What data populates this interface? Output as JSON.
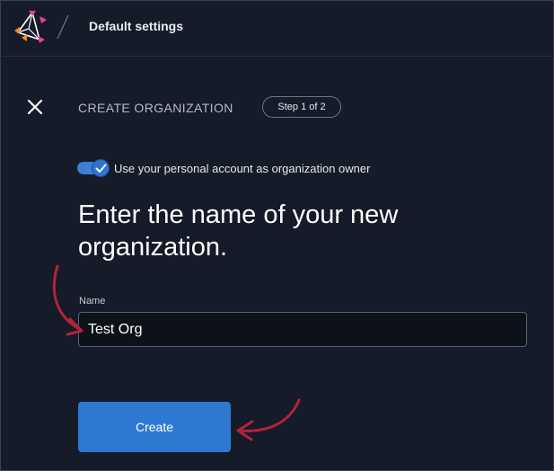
{
  "header": {
    "title": "Default settings"
  },
  "dialog": {
    "heading": "CREATE ORGANIZATION",
    "step": "Step 1 of 2",
    "toggle": {
      "label": "Use your personal account as organization owner",
      "checked": true
    },
    "main_heading": "Enter the name of your new organization.",
    "name_field": {
      "label": "Name",
      "value": "Test Org"
    },
    "create_label": "Create"
  },
  "icons": {
    "logo": "brand-logo-icon",
    "close": "close-icon",
    "check": "check-icon"
  },
  "colors": {
    "background": "#151b28",
    "accent": "#2e78d2",
    "annotation": "#b3233a"
  }
}
